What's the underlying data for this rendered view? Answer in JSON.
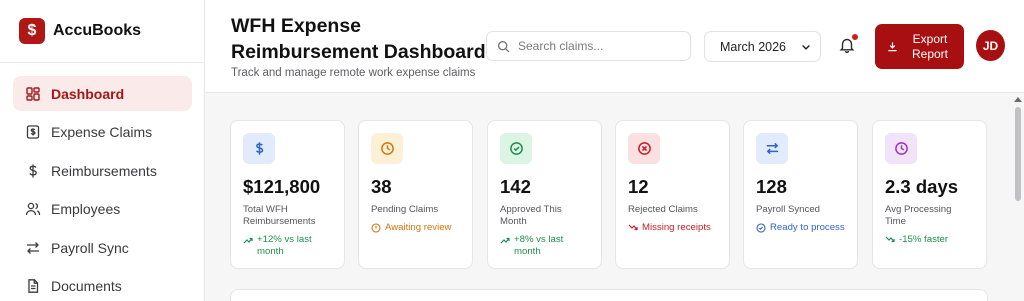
{
  "brand": {
    "name": "AccuBooks",
    "logo_glyph": "$"
  },
  "nav": [
    {
      "label": "Dashboard",
      "icon": "dashboard-grid-icon",
      "active": true
    },
    {
      "label": "Expense Claims",
      "icon": "receipt-icon",
      "active": false
    },
    {
      "label": "Reimbursements",
      "icon": "dollar-icon",
      "active": false
    },
    {
      "label": "Employees",
      "icon": "users-icon",
      "active": false
    },
    {
      "label": "Payroll Sync",
      "icon": "sync-arrows-icon",
      "active": false
    },
    {
      "label": "Documents",
      "icon": "document-icon",
      "active": false
    }
  ],
  "header": {
    "title": "WFH Expense Reimbursement Dashboard",
    "subtitle": "Track and manage remote work expense claims",
    "search_placeholder": "Search claims...",
    "month_selected": "March 2026",
    "export_label": "Export Report",
    "avatar_initials": "JD"
  },
  "colors": {
    "accent": "#a70f10",
    "green": "#1f8f4e",
    "orange": "#d4760c",
    "red": "#c4202a",
    "blue": "#2f63c8"
  },
  "cards": [
    {
      "icon": "dollar-icon",
      "value": "$121,800",
      "label": "Total WFH Reimbursements",
      "note": "+12% vs last month",
      "note_icon": "trend-up-icon",
      "note_color": "#1f8f4e"
    },
    {
      "icon": "clock-icon",
      "value": "38",
      "label": "Pending Claims",
      "note": "Awaiting review",
      "note_icon": "alert-circle-icon",
      "note_color": "#d4760c"
    },
    {
      "icon": "check-circle-icon",
      "value": "142",
      "label": "Approved This Month",
      "note": "+8% vs last month",
      "note_icon": "trend-up-icon",
      "note_color": "#1f8f4e"
    },
    {
      "icon": "x-circle-icon",
      "value": "12",
      "label": "Rejected Claims",
      "note": "Missing receipts",
      "note_icon": "trend-down-icon",
      "note_color": "#c4202a"
    },
    {
      "icon": "sync-arrows-icon",
      "value": "128",
      "label": "Payroll Synced",
      "note": "Ready to process",
      "note_icon": "check-circle-icon",
      "note_color": "#2f63c8"
    },
    {
      "icon": "clock-icon",
      "value": "2.3 days",
      "label": "Avg Processing Time",
      "note": "-15% faster",
      "note_icon": "trend-down-icon",
      "note_color": "#1f8f4e"
    }
  ]
}
